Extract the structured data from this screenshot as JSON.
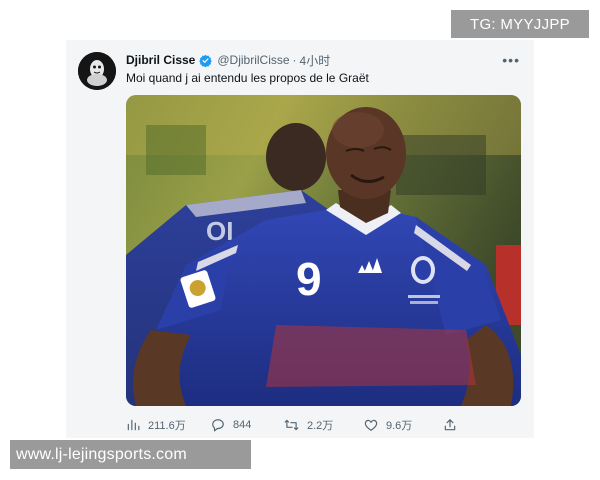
{
  "watermark_top": "TG: MYYJJPP",
  "watermark_bottom": "www.lj-lejingsports.com",
  "tweet": {
    "author_name": "Djibril Cisse",
    "handle": "@DjibrilCisse",
    "separator": "·",
    "time": "4小时",
    "text": "Moi quand j ai entendu les propos de le Graët",
    "jersey_number": "9",
    "verified_color": "#1d9bf0"
  },
  "actions": {
    "views": "211.6万",
    "replies": "844",
    "retweets": "2.2万",
    "likes": "9.6万"
  },
  "icons": [
    "verified-icon",
    "more-icon",
    "views-icon",
    "reply-icon",
    "retweet-icon",
    "like-icon",
    "share-icon"
  ]
}
